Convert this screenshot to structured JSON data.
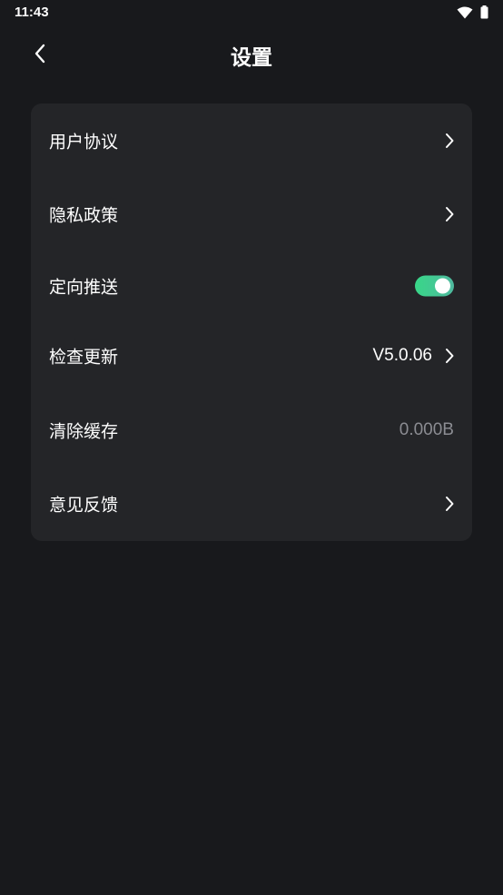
{
  "status_bar": {
    "time": "11:43",
    "icons": [
      "wifi-icon",
      "battery-icon"
    ]
  },
  "header": {
    "title": "设置",
    "back_icon": "chevron-left-icon"
  },
  "settings": {
    "user_agreement": {
      "label": "用户协议"
    },
    "privacy_policy": {
      "label": "隐私政策"
    },
    "targeted_push": {
      "label": "定向推送",
      "enabled": true
    },
    "check_update": {
      "label": "检查更新",
      "value": "V5.0.06"
    },
    "clear_cache": {
      "label": "清除缓存",
      "value": "0.000B"
    },
    "feedback": {
      "label": "意见反馈"
    }
  },
  "colors": {
    "background": "#18191c",
    "card": "#242528",
    "toggle_on_start": "#38d788",
    "toggle_on_end": "#4fb99f",
    "secondary_text": "#8b8c92"
  }
}
